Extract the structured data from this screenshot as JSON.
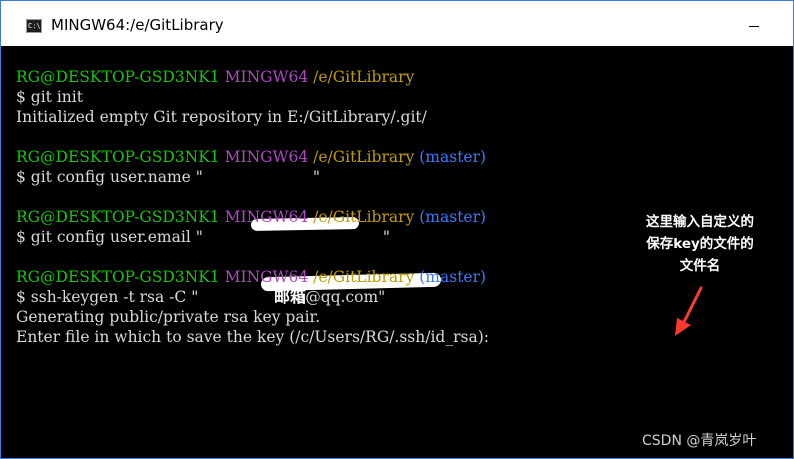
{
  "window": {
    "title": "MINGW64:/e/GitLibrary",
    "icon": "terminal-icon",
    "icon_text": "C:\\"
  },
  "terminal": {
    "block1": {
      "prompt_user": "RG@DESKTOP-GSD3NK1",
      "prompt_env": "MINGW64",
      "prompt_path": "/e/GitLibrary",
      "command": "$ git init",
      "output": "Initialized empty Git repository in E:/GitLibrary/.git/"
    },
    "block2": {
      "prompt_user": "RG@DESKTOP-GSD3NK1",
      "prompt_env": "MINGW64",
      "prompt_path": "/e/GitLibrary",
      "prompt_branch": "(master)",
      "command_prefix": "$ git config user.name \"",
      "command_suffix": "\""
    },
    "block3": {
      "prompt_user": "RG@DESKTOP-GSD3NK1",
      "prompt_env": "MINGW64",
      "prompt_path": "/e/GitLibrary",
      "prompt_branch": "(master)",
      "command_prefix": "$ git config user.email \"",
      "command_suffix": "\""
    },
    "block4": {
      "prompt_user": "RG@DESKTOP-GSD3NK1",
      "prompt_env": "MINGW64",
      "prompt_path": "/e/GitLibrary",
      "prompt_branch": "(master)",
      "command_prefix": "$ ssh-keygen -t rsa -C \"",
      "email_overlay": "邮箱",
      "command_suffix": "5@qq.com\"",
      "output1": "Generating public/private rsa key pair.",
      "output2": "Enter file in which to save the key (/c/Users/RG/.ssh/id_rsa):"
    }
  },
  "annotation": {
    "line1": "这里输入自定义的",
    "line2": "保存key的文件的",
    "line3": "文件名",
    "color": "#ff0000"
  },
  "watermark": "CSDN @青岚岁叶",
  "colors": {
    "prompt_user": "#16c60c",
    "prompt_env": "#b148c6",
    "prompt_path": "#c19c00",
    "prompt_branch": "#3b78ff",
    "text": "#d9d9d9",
    "background": "#000000",
    "arrow": "#ff3b30"
  }
}
